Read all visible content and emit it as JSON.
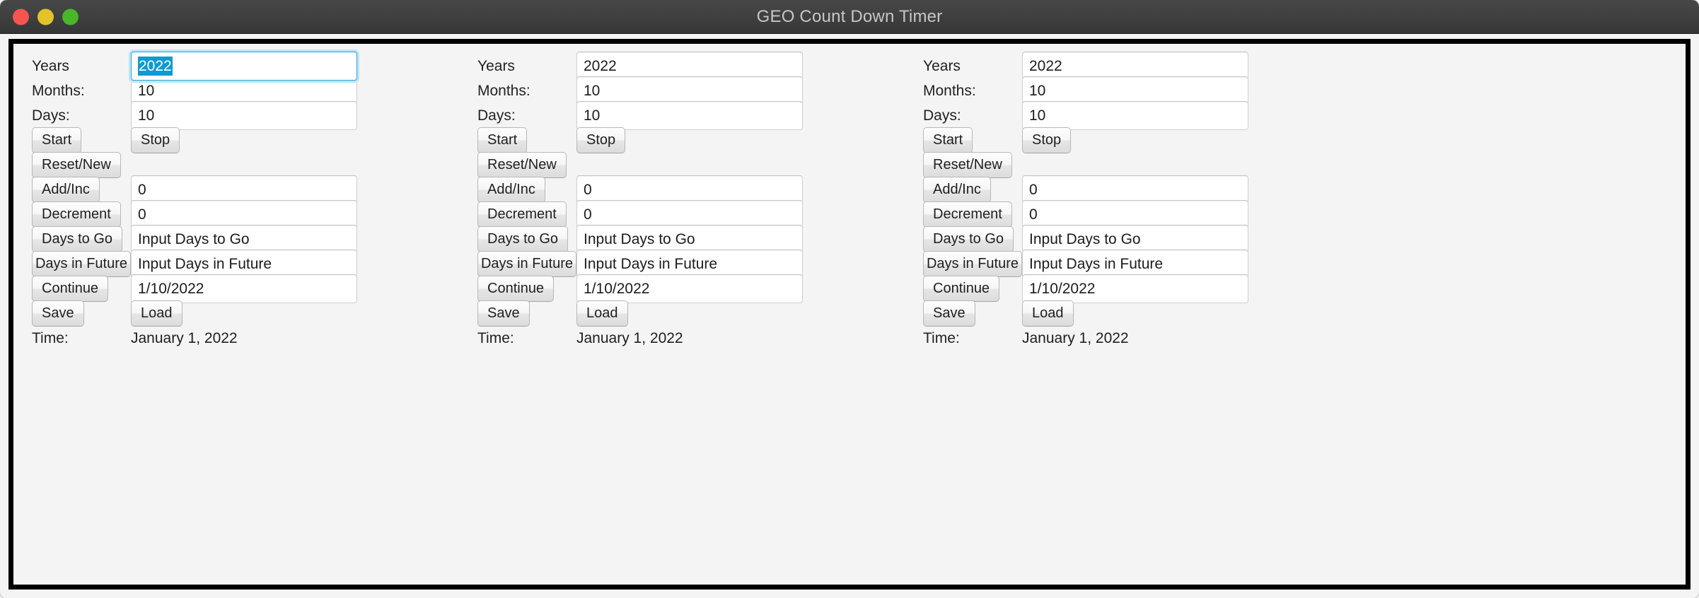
{
  "window": {
    "title": "GEO Count Down Timer",
    "traffic_lights": [
      {
        "name": "close",
        "color": "#f5554d"
      },
      {
        "name": "minimize",
        "color": "#e3c328"
      },
      {
        "name": "maximize",
        "color": "#4ab62a"
      }
    ],
    "accent_selection_color": "#0f9ad3",
    "focus_ring_color": "#31a6de",
    "background_color": "#f4f4f4",
    "titlebar_color": "#404040"
  },
  "panels": [
    {
      "id": "panel-1",
      "years_label": "Years",
      "years_value": "2022",
      "years_focused": true,
      "months_label": "Months:",
      "months_value": "10",
      "days_label": "Days:",
      "days_value": "10",
      "start_label": "Start",
      "stop_label": "Stop",
      "reset_label": "Reset/New",
      "add_label": "Add/Inc",
      "add_value": "0",
      "decrement_label": "Decrement",
      "decrement_value": "0",
      "days_to_go_label": "Days to Go",
      "days_to_go_value": "Input Days to Go",
      "days_in_future_label": "Days in Future",
      "days_in_future_value": "Input Days in Future",
      "continue_label": "Continue",
      "continue_value": "1/10/2022",
      "save_label": "Save",
      "load_label": "Load",
      "time_label": "Time:",
      "time_value": "January 1, 2022"
    },
    {
      "id": "panel-2",
      "years_label": "Years",
      "years_value": "2022",
      "years_focused": false,
      "months_label": "Months:",
      "months_value": "10",
      "days_label": "Days:",
      "days_value": "10",
      "start_label": "Start",
      "stop_label": "Stop",
      "reset_label": "Reset/New",
      "add_label": "Add/Inc",
      "add_value": "0",
      "decrement_label": "Decrement",
      "decrement_value": "0",
      "days_to_go_label": "Days to Go",
      "days_to_go_value": "Input Days to Go",
      "days_in_future_label": "Days in Future",
      "days_in_future_value": "Input Days in Future",
      "continue_label": "Continue",
      "continue_value": "1/10/2022",
      "save_label": "Save",
      "load_label": "Load",
      "time_label": "Time:",
      "time_value": "January 1, 2022"
    },
    {
      "id": "panel-3",
      "years_label": "Years",
      "years_value": "2022",
      "years_focused": false,
      "months_label": "Months:",
      "months_value": "10",
      "days_label": "Days:",
      "days_value": "10",
      "start_label": "Start",
      "stop_label": "Stop",
      "reset_label": "Reset/New",
      "add_label": "Add/Inc",
      "add_value": "0",
      "decrement_label": "Decrement",
      "decrement_value": "0",
      "days_to_go_label": "Days to Go",
      "days_to_go_value": "Input Days to Go",
      "days_in_future_label": "Days in Future",
      "days_in_future_value": "Input Days in Future",
      "continue_label": "Continue",
      "continue_value": "1/10/2022",
      "save_label": "Save",
      "load_label": "Load",
      "time_label": "Time:",
      "time_value": "January 1, 2022"
    }
  ]
}
